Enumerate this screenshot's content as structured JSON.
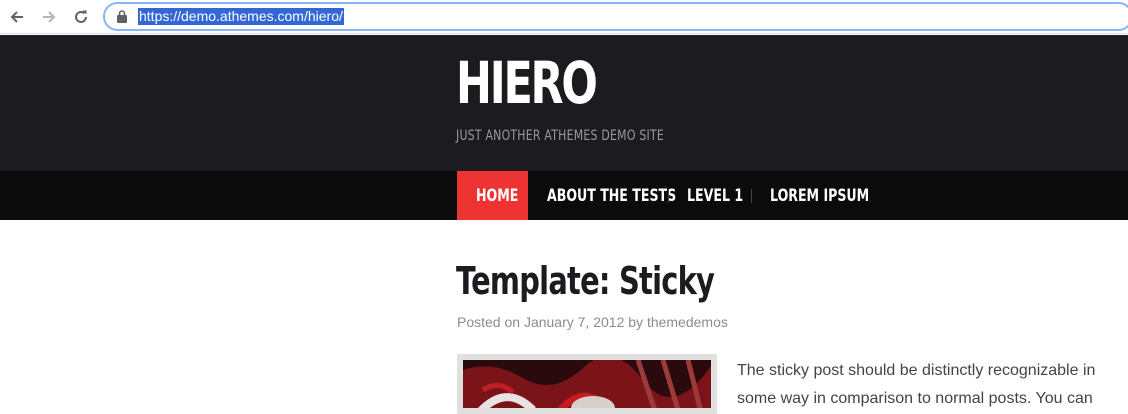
{
  "browser": {
    "url": "https://demo.athemes.com/hiero/"
  },
  "site": {
    "title": "HIERO",
    "description": "JUST ANOTHER ATHEMES DEMO SITE"
  },
  "nav": {
    "items": [
      {
        "label": "HOME",
        "active": true
      },
      {
        "label": "ABOUT THE TESTS"
      },
      {
        "label": "LEVEL 1"
      },
      {
        "label": "LOREM IPSUM"
      }
    ],
    "active_color": "#ee3333"
  },
  "post": {
    "title": "Template: Sticky",
    "meta_prefix": "Posted on",
    "date": "January 7, 2012",
    "meta_by": "by",
    "author": "themedemos",
    "excerpt": "The sticky post should be distinctly recognizable in some way in comparison to normal posts. You can"
  },
  "colors": {
    "header_bg": "#1c1c20",
    "nav_bg": "#0b0b0c",
    "accent": "#ee3333"
  }
}
